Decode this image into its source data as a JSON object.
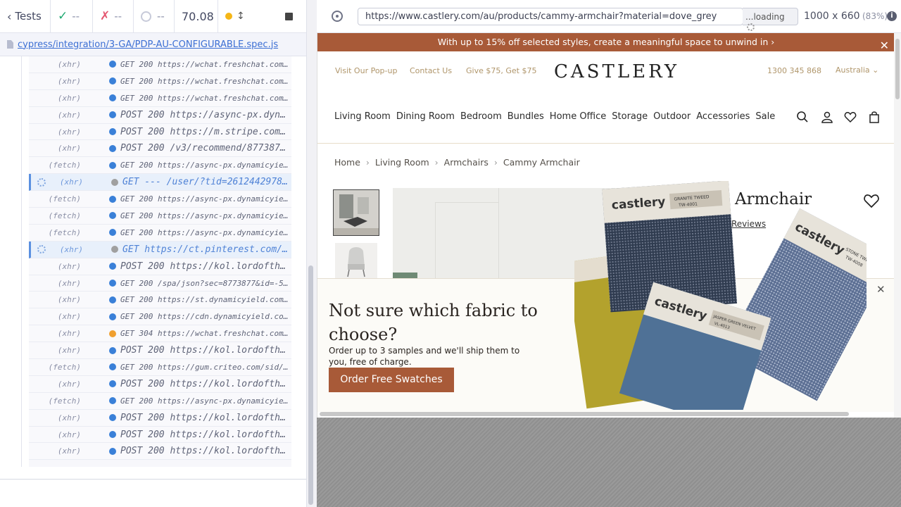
{
  "toolbar": {
    "tests_label": "Tests",
    "passed": "--",
    "failed": "--",
    "pending": "--",
    "duration": "70.08"
  },
  "spec": {
    "path": "cypress/integration/3-GA/PDP-AU-CONFIGURABLE.spec.js"
  },
  "commands": [
    {
      "kind": "(xhr)",
      "msg": "GET 200 https://wchat.freshchat.com/ap…",
      "dot": "#3a80d8",
      "style": "normal"
    },
    {
      "kind": "(xhr)",
      "msg": "GET 200 https://wchat.freshchat.com/ap…",
      "dot": "#3a80d8",
      "style": "normal"
    },
    {
      "kind": "(xhr)",
      "msg": "GET 200 https://wchat.freshchat.com/ap…",
      "dot": "#3a80d8",
      "style": "normal"
    },
    {
      "kind": "(xhr)",
      "msg": "POST 200 https://async-px.dynam…",
      "dot": "#3a80d8",
      "style": "big"
    },
    {
      "kind": "(xhr)",
      "msg": "POST 200 https://m.stripe.com/6",
      "dot": "#3a80d8",
      "style": "big"
    },
    {
      "kind": "(xhr)",
      "msg": "POST 200 /v3/recommend/8773877?…",
      "dot": "#3a80d8",
      "style": "big"
    },
    {
      "kind": "(fetch)",
      "msg": "GET 200 https://async-px.dynamicyield…",
      "dot": "#3a80d8",
      "style": "normal"
    },
    {
      "kind": "(xhr)",
      "msg": "GET --- /user/?tid=261244297876…",
      "dot": "#a0a0a0",
      "style": "pending"
    },
    {
      "kind": "(fetch)",
      "msg": "GET 200 https://async-px.dynamicyield…",
      "dot": "#3a80d8",
      "style": "normal"
    },
    {
      "kind": "(fetch)",
      "msg": "GET 200 https://async-px.dynamicyield…",
      "dot": "#3a80d8",
      "style": "normal"
    },
    {
      "kind": "(fetch)",
      "msg": "GET 200 https://async-px.dynamicyield…",
      "dot": "#3a80d8",
      "style": "normal"
    },
    {
      "kind": "(xhr)",
      "msg": "GET https://ct.pinterest.com/us…",
      "dot": "#a0a0a0",
      "style": "pending"
    },
    {
      "kind": "(xhr)",
      "msg": "POST 200 https://kol.lordofthee…",
      "dot": "#3a80d8",
      "style": "big"
    },
    {
      "kind": "(xhr)",
      "msg": "GET 200 /spa/json?sec=8773877&id=-5048…",
      "dot": "#3a80d8",
      "style": "normal"
    },
    {
      "kind": "(xhr)",
      "msg": "GET 200 https://st.dynamicyield.com/sp…",
      "dot": "#3a80d8",
      "style": "normal"
    },
    {
      "kind": "(xhr)",
      "msg": "GET 200 https://cdn.dynamicyield.com/v…",
      "dot": "#3a80d8",
      "style": "normal"
    },
    {
      "kind": "(xhr)",
      "msg": "GET 304 https://wchat.freshchat.com/ap…",
      "dot": "#f0a030",
      "style": "normal"
    },
    {
      "kind": "(xhr)",
      "msg": "POST 200 https://kol.lordofthee…",
      "dot": "#3a80d8",
      "style": "big"
    },
    {
      "kind": "(fetch)",
      "msg": "GET 200 https://gum.criteo.com/sid/jso…",
      "dot": "#3a80d8",
      "style": "normal"
    },
    {
      "kind": "(xhr)",
      "msg": "POST 200 https://kol.lordofthee…",
      "dot": "#3a80d8",
      "style": "big"
    },
    {
      "kind": "(fetch)",
      "msg": "GET 200 https://async-px.dynamicyield…",
      "dot": "#3a80d8",
      "style": "normal"
    },
    {
      "kind": "(xhr)",
      "msg": "POST 200 https://kol.lordofthee…",
      "dot": "#3a80d8",
      "style": "big"
    },
    {
      "kind": "(xhr)",
      "msg": "POST 200 https://kol.lordofthee…",
      "dot": "#3a80d8",
      "style": "big"
    },
    {
      "kind": "(xhr)",
      "msg": "POST 200 https://kol.lordofthee…",
      "dot": "#3a80d8",
      "style": "big"
    }
  ],
  "aut": {
    "url": "https://www.castlery.com/au/products/cammy-armchair?material=dove_grey",
    "loading": "...loading",
    "viewport": "1000 x 660",
    "scale": "(83%)",
    "info": "i"
  },
  "site": {
    "promo": "With up to 15% off selected styles, create a meaningful space to unwind in ›",
    "toplinks": [
      "Visit Our Pop-up",
      "Contact Us",
      "Give $75, Get $75"
    ],
    "logo": "CASTLERY",
    "phone": "1300 345 868",
    "country": "Australia",
    "nav": [
      "Living Room",
      "Dining Room",
      "Bedroom",
      "Bundles",
      "Home Office",
      "Storage",
      "Outdoor",
      "Accessories",
      "Sale"
    ],
    "breadcrumb": [
      "Home",
      "Living Room",
      "Armchairs",
      "Cammy Armchair"
    ],
    "product_title": "Armchair",
    "reviews": "Reviews",
    "popup": {
      "title": "Not sure which fabric to choose?",
      "body": "Order up to 3 samples and we'll ship them to you, free of charge.",
      "button": "Order Free Swatches"
    },
    "swatch_brand": "castlery",
    "swatch_labels": [
      "GRANITE TWEED",
      "TW-4001",
      "JASPER GREEN VELVET",
      "VL-4013",
      "STONE TWEED",
      "TW-4008"
    ]
  },
  "colors": {
    "brand": "#a85a38",
    "accent_gold": "#b0966b",
    "cypress_blue": "#3c6fd4"
  }
}
